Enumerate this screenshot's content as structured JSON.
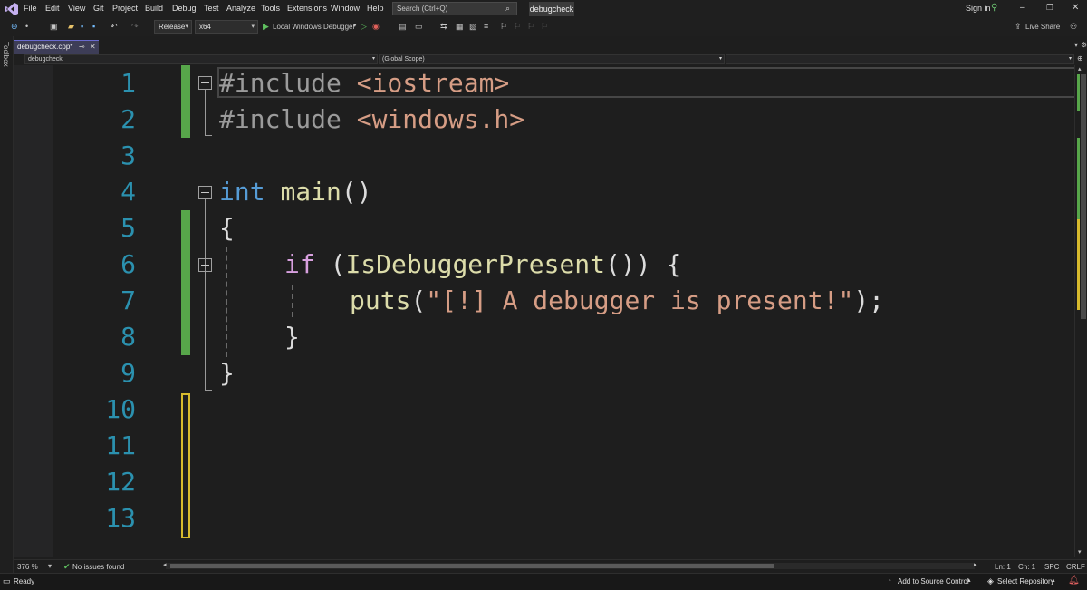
{
  "menubar": {
    "items": [
      "File",
      "Edit",
      "View",
      "Git",
      "Project",
      "Build",
      "Debug",
      "Test",
      "Analyze",
      "Tools",
      "Extensions",
      "Window",
      "Help"
    ],
    "search_placeholder": "Search (Ctrl+Q)",
    "solution_name": "debugcheck",
    "sign_in": "Sign in"
  },
  "toolbar": {
    "configuration": "Release",
    "platform": "x64",
    "debugger_label": "Local Windows Debugger",
    "live_share": "Live Share"
  },
  "toolbox_label": "Toolbox",
  "tab": {
    "title": "debugcheck.cpp*"
  },
  "navbar": {
    "project": "debugcheck",
    "scope": "(Global Scope)"
  },
  "editor": {
    "line_numbers": [
      "1",
      "2",
      "3",
      "4",
      "5",
      "6",
      "7",
      "8",
      "9",
      "10",
      "11",
      "12",
      "13"
    ],
    "code": {
      "l1_pre": "#include",
      "l1_hdr": "<iostream>",
      "l2_pre": "#include",
      "l2_hdr": "<windows.h>",
      "l4_kw": "int",
      "l4_fn": "main",
      "l4_rest": "()",
      "l5": "{",
      "l6_kw": "if",
      "l6_a": " (",
      "l6_fn": "IsDebuggerPresent",
      "l6_b": "()) {",
      "l7_fn": "puts",
      "l7_a": "(",
      "l7_str": "\"[!] A debugger is present!\"",
      "l7_b": ");",
      "l8": "}",
      "l9": "}"
    },
    "colors": {
      "saved_change": "#57a64a",
      "unsaved_change": "#d7ba2d",
      "line_number": "#2b91af"
    }
  },
  "edstatus": {
    "zoom": "376 %",
    "issues": "No issues found",
    "ln": "Ln: 1",
    "ch": "Ch: 1",
    "spc": "SPC",
    "crlf": "CRLF"
  },
  "statusbar": {
    "ready": "Ready",
    "source_control": "Add to Source Control",
    "repo": "Select Repository"
  }
}
